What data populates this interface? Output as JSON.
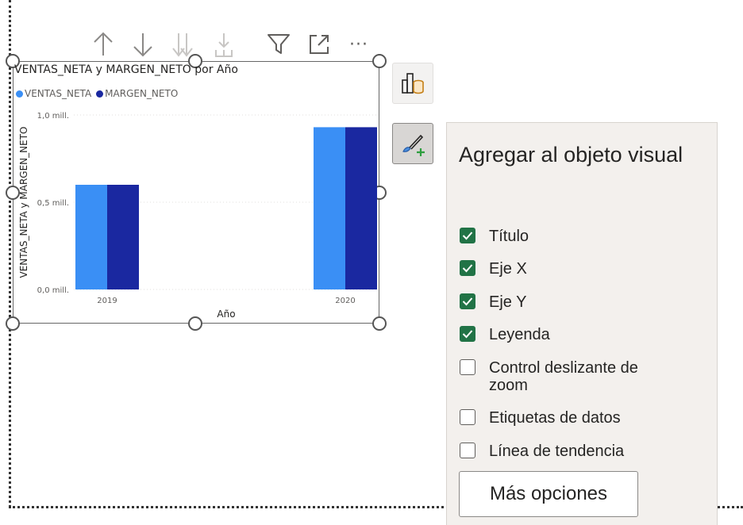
{
  "toolbar": {
    "icons": [
      "arrow-up-icon",
      "arrow-down-icon",
      "double-arrow-down-icon",
      "expand-hierarchy-icon",
      "filter-icon",
      "focus-mode-icon",
      "more-options-icon"
    ],
    "more_glyph": "···"
  },
  "chart_data": {
    "type": "bar",
    "title": "VENTAS_NETA y MARGEN_NETO por Año",
    "xlabel": "Año",
    "ylabel": "VENTAS_NETA y MARGEN_NETO",
    "categories": [
      "2019",
      "2020"
    ],
    "series": [
      {
        "name": "VENTAS_NETA",
        "color": "#3a8ff5",
        "values": [
          0.6,
          0.93
        ]
      },
      {
        "name": "MARGEN_NETO",
        "color": "#1a28a0",
        "values": [
          0.6,
          0.93
        ]
      }
    ],
    "ylim": [
      0,
      1.0
    ],
    "yticks": [
      {
        "value": 0.0,
        "label": "0,0 mill."
      },
      {
        "value": 0.5,
        "label": "0,5 mill."
      },
      {
        "value": 1.0,
        "label": "1,0 mill."
      }
    ],
    "grid": true,
    "legend_position": "top-left"
  },
  "side_buttons": {
    "fields": "build-visual-icon",
    "format": "format-visual-icon"
  },
  "panel": {
    "title": "Agregar al objeto visual",
    "options": [
      {
        "label": "Título",
        "checked": true
      },
      {
        "label": "Eje X",
        "checked": true
      },
      {
        "label": "Eje Y",
        "checked": true
      },
      {
        "label": "Leyenda",
        "checked": true
      },
      {
        "label": "Control deslizante de zoom",
        "checked": false
      },
      {
        "label": "Etiquetas de datos",
        "checked": false
      },
      {
        "label": "Línea de tendencia",
        "checked": false
      }
    ],
    "more_button": "Más opciones"
  }
}
